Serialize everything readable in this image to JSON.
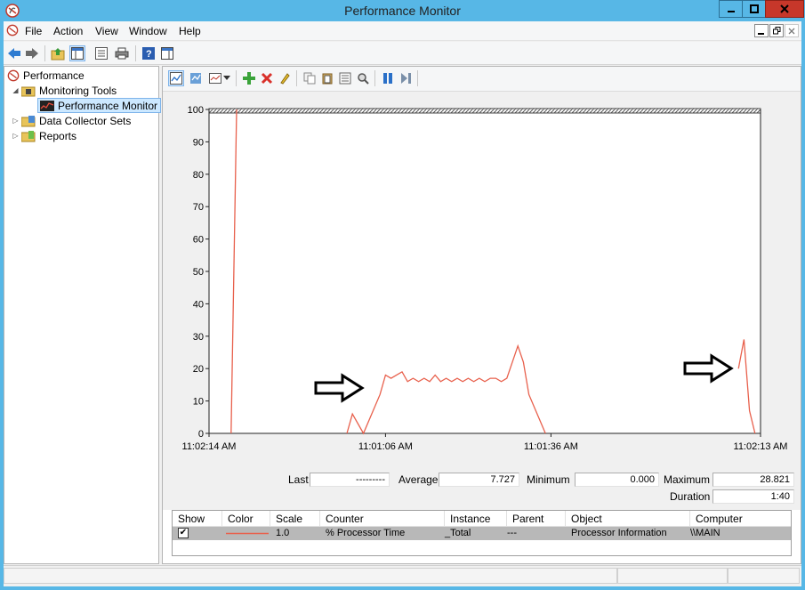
{
  "window": {
    "title": "Performance Monitor"
  },
  "menu": {
    "items": [
      "File",
      "Action",
      "View",
      "Window",
      "Help"
    ]
  },
  "tree": {
    "root": "Performance",
    "monitoring_tools": "Monitoring Tools",
    "performance_monitor": "Performance Monitor",
    "data_collector_sets": "Data Collector Sets",
    "reports": "Reports"
  },
  "stats": {
    "last_label": "Last",
    "last_value": "---------",
    "average_label": "Average",
    "average_value": "7.727",
    "minimum_label": "Minimum",
    "minimum_value": "0.000",
    "maximum_label": "Maximum",
    "maximum_value": "28.821",
    "duration_label": "Duration",
    "duration_value": "1:40"
  },
  "legend": {
    "headers": [
      "Show",
      "Color",
      "Scale",
      "Counter",
      "Instance",
      "Parent",
      "Object",
      "Computer"
    ],
    "row": {
      "show": true,
      "scale": "1.0",
      "counter": "% Processor Time",
      "instance": "_Total",
      "parent": "---",
      "object": "Processor Information",
      "computer": "\\\\MAIN"
    }
  },
  "chart_data": {
    "type": "line",
    "title": "",
    "xlabel": "",
    "ylabel": "",
    "ylim": [
      0,
      100
    ],
    "yticks": [
      0,
      10,
      20,
      30,
      40,
      50,
      60,
      70,
      80,
      90,
      100
    ],
    "xticks": [
      "11:02:14 AM",
      "11:01:06 AM",
      "11:01:36 AM",
      "11:02:13 AM"
    ],
    "grid": false,
    "series": [
      {
        "color": "#e8604c",
        "x": [
          4,
          5,
          25,
          26,
          28,
          31,
          32,
          33,
          34,
          35,
          36,
          37,
          38,
          39,
          40,
          41,
          42,
          43,
          44,
          45,
          46,
          47,
          48,
          49,
          50,
          51,
          52,
          53,
          54,
          55,
          56,
          57,
          58,
          61,
          96,
          97,
          98,
          99
        ],
        "y": [
          0,
          100,
          0,
          6,
          0,
          12,
          18,
          17,
          18,
          19,
          16,
          17,
          16,
          17,
          16,
          18,
          16,
          17,
          16,
          17,
          16,
          17,
          16,
          17,
          16,
          17,
          17,
          16,
          17,
          22,
          27,
          22,
          12,
          0,
          20,
          29,
          7,
          0
        ]
      }
    ]
  }
}
